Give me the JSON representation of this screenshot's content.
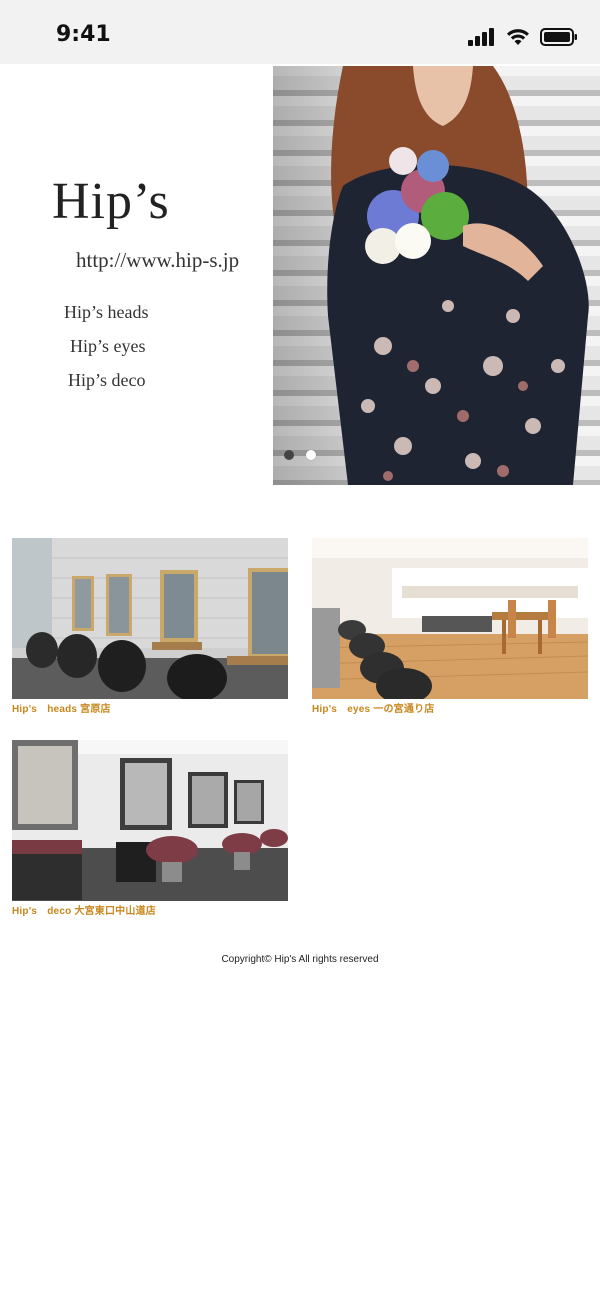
{
  "status_bar": {
    "time": "9:41",
    "icons": [
      "signal-icon",
      "wifi-icon",
      "battery-icon"
    ]
  },
  "hero": {
    "title": "Hip’s",
    "url": "http://www.hip-s.jp",
    "links": [
      "Hip’s heads",
      "Hip’s eyes",
      "Hip’s deco"
    ],
    "carousel": {
      "slides": 2,
      "active_slide": 2
    }
  },
  "salons": [
    {
      "caption": "Hip's　heads 宮原店"
    },
    {
      "caption": "Hip's　eyes 一の宮通り店"
    },
    {
      "caption": "Hip's　deco 大宮東口中山道店"
    }
  ],
  "footer": {
    "copyright": "Copyright© Hip's All rights reserved"
  },
  "colors": {
    "caption": "#c8861c",
    "status_bar_bg": "#f3f2f3"
  }
}
